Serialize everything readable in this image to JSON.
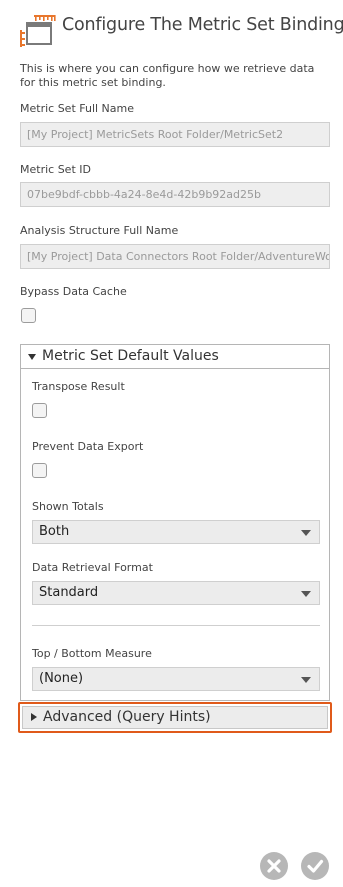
{
  "header": {
    "title": "Configure The Metric Set Binding",
    "icon": "metric-set-binding-icon",
    "accent_color": "#e8762c"
  },
  "description": "This is where you can configure how we retrieve data for this metric set binding.",
  "fields": {
    "metric_set_full_name": {
      "label": "Metric Set Full Name",
      "value": "[My Project] MetricSets Root Folder/MetricSet2"
    },
    "metric_set_id": {
      "label": "Metric Set ID",
      "value": "07be9bdf-cbbb-4a24-8e4d-42b9b92ad25b"
    },
    "analysis_structure_full_name": {
      "label": "Analysis Structure Full Name",
      "value": "[My Project] Data Connectors Root Folder/AdventureWo"
    },
    "bypass_data_cache": {
      "label": "Bypass Data Cache",
      "checked": false
    }
  },
  "default_values_panel": {
    "title": "Metric Set Default Values",
    "expanded": true,
    "transpose_result": {
      "label": "Transpose Result",
      "checked": false
    },
    "prevent_data_export": {
      "label": "Prevent Data Export",
      "checked": false
    },
    "shown_totals": {
      "label": "Shown Totals",
      "value": "Both"
    },
    "data_retrieval_format": {
      "label": "Data Retrieval Format",
      "value": "Standard"
    },
    "top_bottom_measure": {
      "label": "Top / Bottom Measure",
      "value": "(None)"
    }
  },
  "advanced_panel": {
    "title": "Advanced (Query Hints)",
    "expanded": false,
    "highlight_color": "#e05a1a"
  },
  "footer": {
    "cancel_icon": "close-icon",
    "confirm_icon": "check-icon",
    "button_color": "#b7b7b7"
  }
}
